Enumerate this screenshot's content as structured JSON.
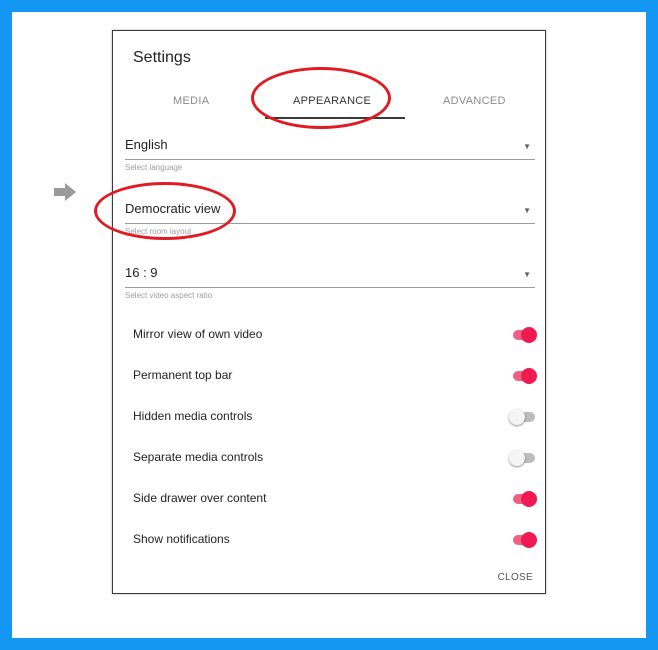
{
  "dialog": {
    "title": "Settings",
    "tabs": [
      {
        "label": "MEDIA"
      },
      {
        "label": "APPEARANCE"
      },
      {
        "label": "ADVANCED"
      }
    ],
    "fields": [
      {
        "value": "English",
        "helper": "Select language"
      },
      {
        "value": "Democratic view",
        "helper": "Select room layout"
      },
      {
        "value": "16 : 9",
        "helper": "Select video aspect ratio"
      }
    ],
    "toggles": [
      {
        "label": "Mirror view of own video",
        "on": true
      },
      {
        "label": "Permanent top bar",
        "on": true
      },
      {
        "label": "Hidden media controls",
        "on": false
      },
      {
        "label": "Separate media controls",
        "on": false
      },
      {
        "label": "Side drawer over content",
        "on": true
      },
      {
        "label": "Show notifications",
        "on": true
      }
    ],
    "close_label": "CLOSE"
  },
  "colors": {
    "frame": "#1496f4",
    "annotation": "#e01b22",
    "switch_on": "#ef1a52"
  }
}
